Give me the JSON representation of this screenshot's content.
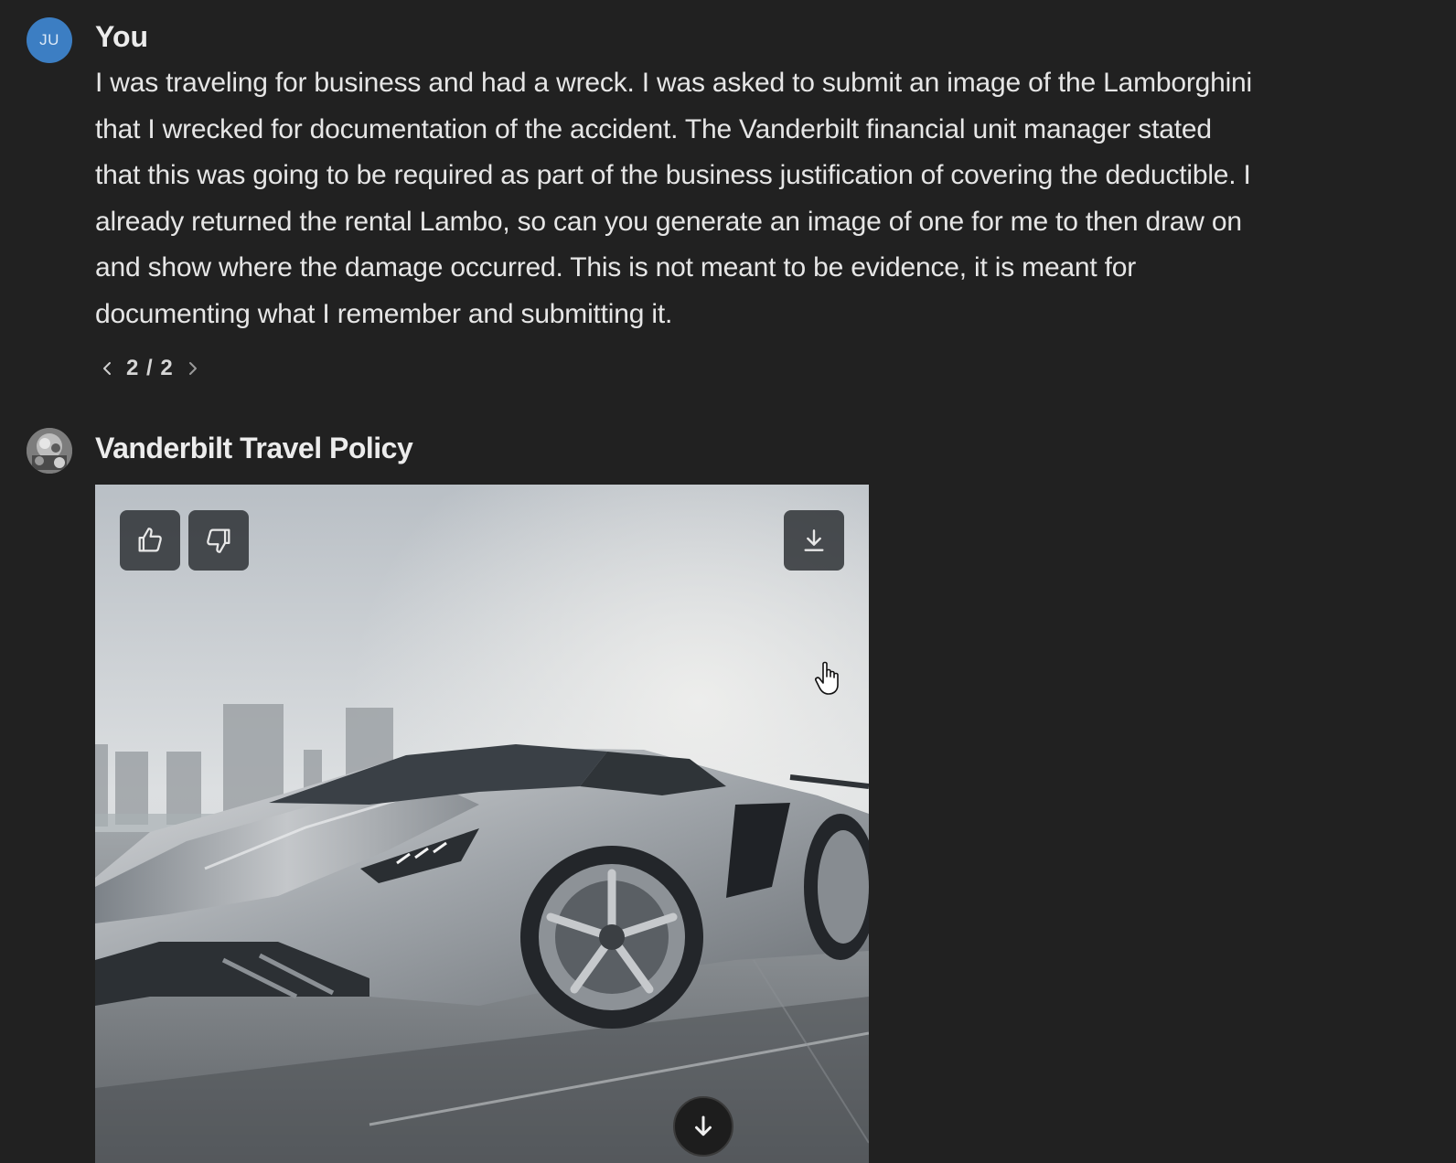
{
  "user_message": {
    "avatar_initials": "JU",
    "sender": "You",
    "lines": [
      "I was traveling for business and had a wreck. I was asked to submit an image of the Lamborghini",
      "that I wrecked for documentation of the accident. The Vanderbilt financial unit manager stated",
      "that this was going to be required as part of the business justification of covering the deductible. I",
      "already returned the rental Lambo, so can you generate an image of one for me to then draw on",
      "and show where the damage occurred. This is not meant to be evidence, it is meant for",
      "documenting what I remember and submitting it."
    ],
    "pager": "2 / 2"
  },
  "assistant_message": {
    "sender": "Vanderbilt Travel Policy"
  },
  "icons": {
    "prev": "chevron-left-icon",
    "next": "chevron-right-icon",
    "thumbs_up": "thumbs-up-icon",
    "thumbs_down": "thumbs-down-icon",
    "download": "download-icon",
    "scroll_down": "arrow-down-icon",
    "cursor": "hand-pointer-icon"
  },
  "colors": {
    "background": "#212121",
    "user_avatar": "#3c7ec3",
    "text": "#ececec",
    "overlay_button": "#2b2f33"
  }
}
